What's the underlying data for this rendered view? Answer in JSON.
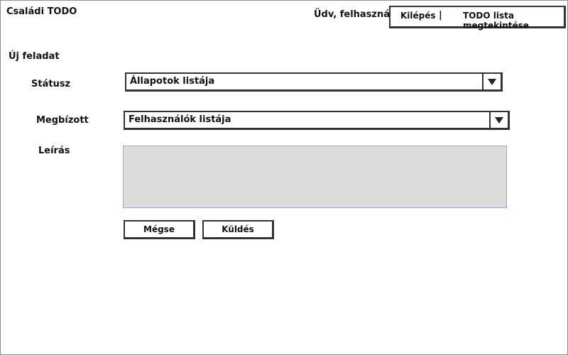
{
  "header": {
    "app_title": "Családi TODO",
    "welcome": "Üdv, felhasználó!",
    "nav": {
      "logout": "Kilépés",
      "separator": "|",
      "view_list": "TODO lista megtekintése"
    }
  },
  "form": {
    "title": "Új feladat",
    "status": {
      "label": "Státusz",
      "value": "Állapotok listája"
    },
    "assignee": {
      "label": "Megbízott",
      "value": "Felhasználók listája"
    },
    "description": {
      "label": "Leírás",
      "value": ""
    },
    "buttons": {
      "cancel": "Mégse",
      "submit": "Küldés"
    }
  },
  "colors": {
    "textarea_bg": "#dcdcdc",
    "textarea_border": "#8da4ee"
  }
}
